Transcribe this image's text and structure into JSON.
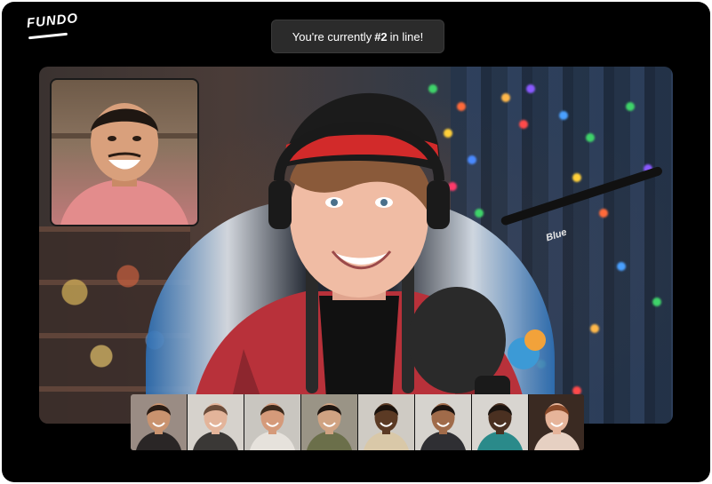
{
  "app": {
    "logo_text": "FUNDO"
  },
  "queue": {
    "prefix": "You're currently",
    "position": "#2",
    "suffix": "in line!"
  },
  "colors": {
    "frame_bg": "#000000",
    "pill_bg": "#2b2b2b",
    "text": "#ffffff"
  },
  "stage": {
    "mic_brand": "Blue"
  },
  "participants": [
    {
      "icon": "participant-1-avatar",
      "bg": "#9a8c84",
      "skin": "#c9936f",
      "hair": "#2a1c14",
      "shirt": "#2a2626"
    },
    {
      "icon": "participant-2-avatar",
      "bg": "#d6d2cc",
      "skin": "#e3b49a",
      "hair": "#6b4c3a",
      "shirt": "#3a3836"
    },
    {
      "icon": "participant-3-avatar",
      "bg": "#c9c6c0",
      "skin": "#d59a7a",
      "hair": "#3c2a1c",
      "shirt": "#e6e2dc"
    },
    {
      "icon": "participant-4-avatar",
      "bg": "#9a9486",
      "skin": "#d0a382",
      "hair": "#1e1510",
      "shirt": "#6b6f4a"
    },
    {
      "icon": "participant-5-avatar",
      "bg": "#cfcbc4",
      "skin": "#5b3a24",
      "hair": "#1a120c",
      "shirt": "#d9c8a8"
    },
    {
      "icon": "participant-6-avatar",
      "bg": "#d6d3ce",
      "skin": "#a06b4a",
      "hair": "#1c1410",
      "shirt": "#2f2f33"
    },
    {
      "icon": "participant-7-avatar",
      "bg": "#d8d5d0",
      "skin": "#4a3021",
      "hair": "#1a1410",
      "shirt": "#2a8a8a"
    },
    {
      "icon": "participant-8-avatar",
      "bg": "#3a2a22",
      "skin": "#e6b49a",
      "hair": "#8a4a2a",
      "shirt": "#e6d0c2"
    }
  ]
}
